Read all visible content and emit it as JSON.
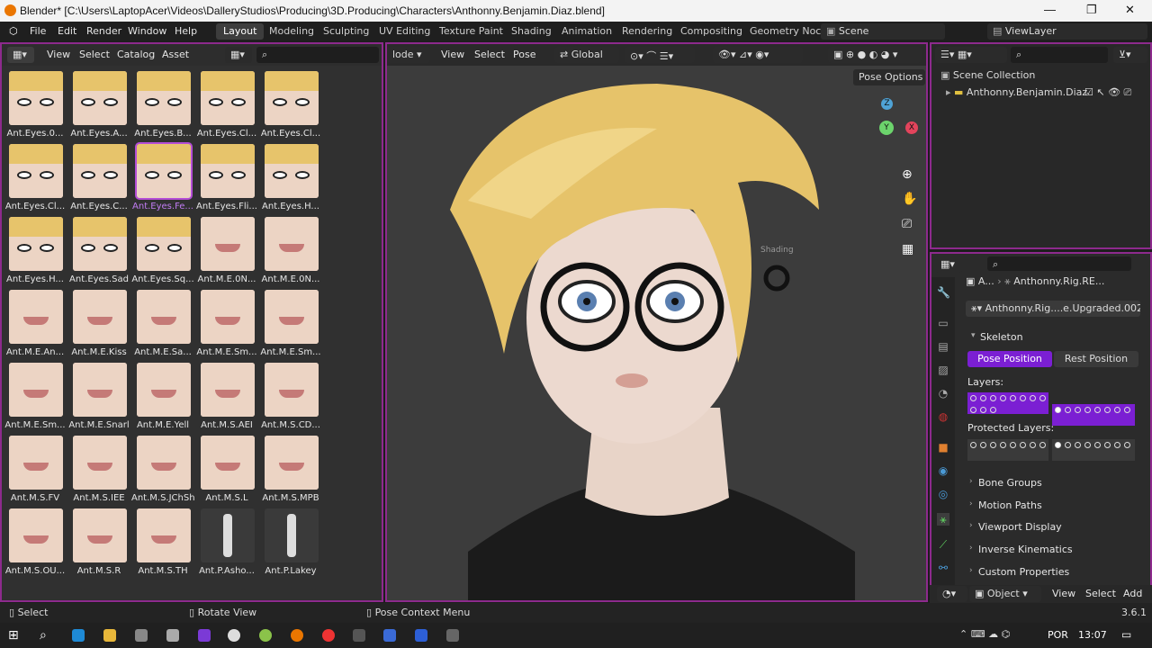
{
  "title_bar": {
    "title": "Blender* [C:\\Users\\LaptopAcer\\Videos\\DalleryStudios\\Producing\\3D.Producing\\Characters\\Anthonny.Benjamin.Diaz.blend]",
    "min": "—",
    "max": "❐",
    "close": "✕"
  },
  "menu": [
    "File",
    "Edit",
    "Render",
    "Window",
    "Help"
  ],
  "workspaces": [
    "Layout",
    "Modeling",
    "Sculpting",
    "UV Editing",
    "Texture Paint",
    "Shading",
    "Animation",
    "Rendering",
    "Compositing",
    "Geometry Noc"
  ],
  "scene": "Scene",
  "view_layer": "ViewLayer",
  "asset_browser": {
    "menu": [
      "View",
      "Select",
      "Catalog",
      "Asset"
    ],
    "items": [
      "Ant.Eyes.0...",
      "Ant.Eyes.A...",
      "Ant.Eyes.B...",
      "Ant.Eyes.Cl...",
      "Ant.Eyes.Cl...",
      "Ant.Eyes.Cl...",
      "Ant.Eyes.C...",
      "Ant.Eyes.Fe...",
      "Ant.Eyes.Fli...",
      "Ant.Eyes.H...",
      "Ant.Eyes.H...",
      "Ant.Eyes.Sad",
      "Ant.Eyes.Sq...",
      "Ant.M.E.0N...",
      "Ant.M.E.0N...",
      "Ant.M.E.An...",
      "Ant.M.E.Kiss",
      "Ant.M.E.Sa...",
      "Ant.M.E.Sm...",
      "Ant.M.E.Sm...",
      "Ant.M.E.Sm...",
      "Ant.M.E.Snarl",
      "Ant.M.E.Yell",
      "Ant.M.S.AEI",
      "Ant.M.S.CD...",
      "Ant.M.S.FV",
      "Ant.M.S.IEE",
      "Ant.M.S.JChSh",
      "Ant.M.S.L",
      "Ant.M.S.MPB",
      "Ant.M.S.OU...",
      "Ant.M.S.R",
      "Ant.M.S.TH",
      "Ant.P.Asho...",
      "Ant.P.Lakey"
    ],
    "selected_index": 7
  },
  "viewport": {
    "mode": "lode",
    "menu": [
      "View",
      "Select",
      "Pose"
    ],
    "orientation": "Global",
    "pose_options": "Pose Options",
    "tooltip": "Shading",
    "axes": {
      "x": "X",
      "y": "Y",
      "z": "Z"
    }
  },
  "outliner": {
    "root": "Scene Collection",
    "item": "Anthonny.Benjamin.Diaz"
  },
  "properties": {
    "breadcrumb_a": "A...",
    "breadcrumb_b": "Anthonny.Rig.RE...",
    "datablock": "Anthonny.Rig....e.Upgraded.002",
    "skeleton": "Skeleton",
    "pose_position": "Pose Position",
    "rest_position": "Rest Position",
    "layers": "Layers:",
    "protected_layers": "Protected Layers:",
    "sections": [
      "Bone Groups",
      "Motion Paths",
      "Viewport Display",
      "Inverse Kinematics",
      "Custom Properties"
    ]
  },
  "bottom_editor": {
    "mode": "Object",
    "menu": [
      "View",
      "Select",
      "Add"
    ]
  },
  "status_bar": {
    "select": "Select",
    "rotate": "Rotate View",
    "context": "Pose Context Menu",
    "version": "3.6.1"
  },
  "taskbar": {
    "lang": "POR",
    "time": "13:07"
  },
  "colors": {
    "accent": "#8d2a8d",
    "selected": "#7b1fd3",
    "hair": "#e8c46a",
    "skin": "#ead3c6"
  }
}
